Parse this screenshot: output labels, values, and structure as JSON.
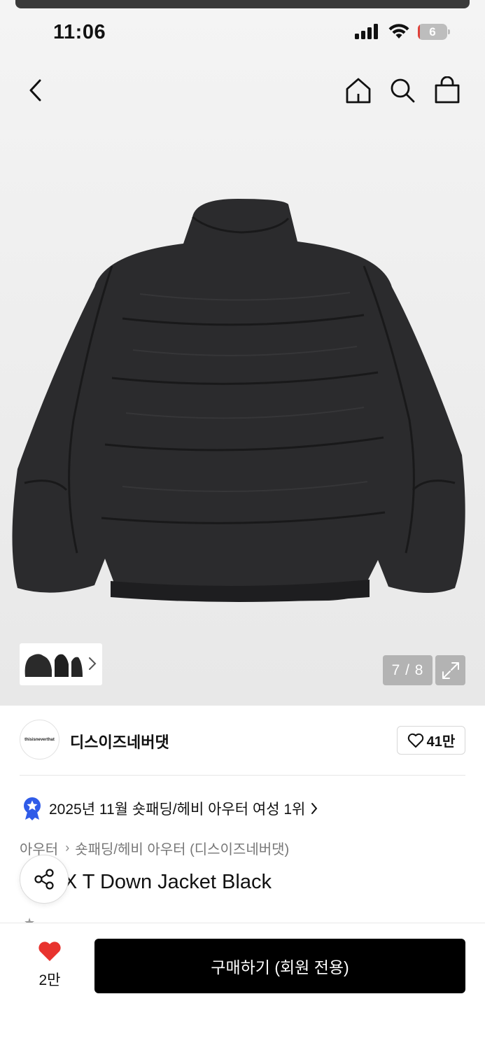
{
  "status_bar": {
    "time": "11:06",
    "battery": "6",
    "battery_level": 0.06,
    "signal_bars": 4,
    "icons": [
      "cellular-signal-icon",
      "wifi-icon",
      "battery-icon"
    ]
  },
  "nav": {
    "icons": [
      "back-arrow-icon",
      "home-icon",
      "search-icon",
      "shopping-bag-icon"
    ]
  },
  "gallery": {
    "counter": "7 / 8",
    "current_index": 7,
    "total": 8,
    "thumbnail_icon": "chevron-right-icon",
    "expand_icon": "expand-icon"
  },
  "brand": {
    "logo_text": "thisisneverthat",
    "name": "디스이즈네버댓",
    "like_count": "41만",
    "like_icon": "heart-outline-icon"
  },
  "ranking": {
    "badge_icon": "star-medal-icon",
    "text": "2025년 11월 숏패딩/헤비 아우터 여성 1위"
  },
  "breadcrumb": {
    "level1": "아우터",
    "level2": "숏패딩/헤비 아우터 (디스이즈네버댓)"
  },
  "product": {
    "title": "L-TEX T Down Jacket Black",
    "share_icon": "share-icon"
  },
  "footer": {
    "wish_icon": "heart-filled-icon",
    "wish_count": "2만",
    "buy_label": "구매하기 (회원 전용)"
  },
  "colors": {
    "accent_red": "#e8332e",
    "primary_black": "#000000",
    "badge_blue": "#2f5be8",
    "overlay_gray": "#b3b3b3"
  }
}
